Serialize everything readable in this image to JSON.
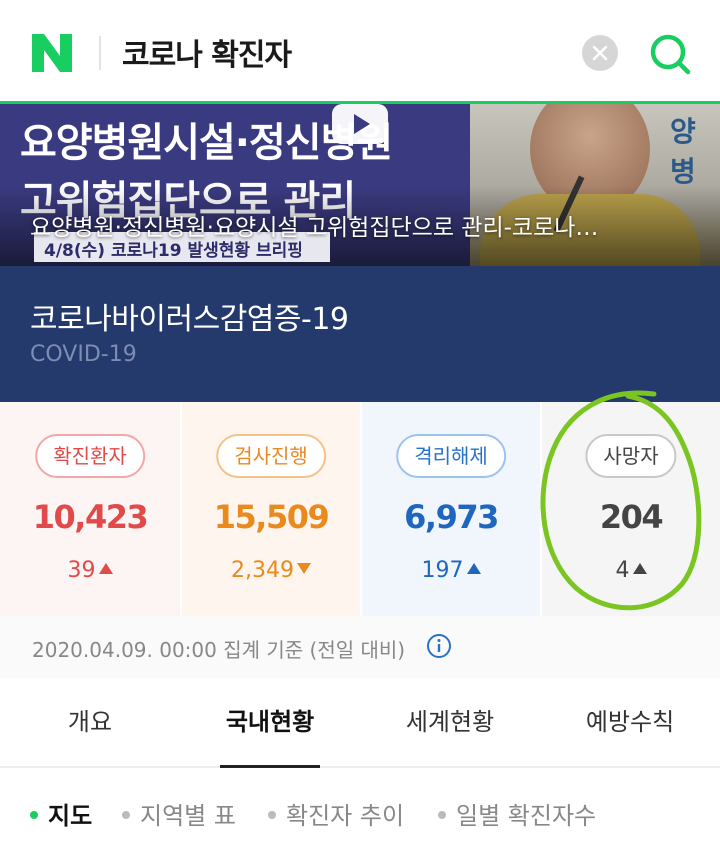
{
  "header": {
    "query": "코로나 확진자",
    "brand_color": "#19ce60"
  },
  "banner": {
    "headline_line1": "요양병원시설·정신병원",
    "headline_line2": "고위험집단으로 관리",
    "sign_text": "양병",
    "date_tag": "4/8(수) 코로나19 발생현황 브리핑",
    "caption": "요양병원·정신병원·요양시설 고위험집단으로 관리-코로나…"
  },
  "title": {
    "korean": "코로나바이러스감염증-19",
    "english": "COVID-19"
  },
  "stats": [
    {
      "label": "확진환자",
      "value": "10,423",
      "delta": "39",
      "direction": "up",
      "color": "#e04a4a"
    },
    {
      "label": "검사진행",
      "value": "15,509",
      "delta": "2,349",
      "direction": "down",
      "color": "#e98a1f"
    },
    {
      "label": "격리해제",
      "value": "6,973",
      "delta": "197",
      "direction": "up",
      "color": "#1f66bf"
    },
    {
      "label": "사망자",
      "value": "204",
      "delta": "4",
      "direction": "up",
      "color": "#444444"
    }
  ],
  "basis": {
    "text": "2020.04.09. 00:00 집계 기준 (전일 대비)"
  },
  "tabs": [
    {
      "label": "개요"
    },
    {
      "label": "국내현황",
      "active": true
    },
    {
      "label": "세계현황"
    },
    {
      "label": "예방수칙"
    }
  ],
  "subnav": [
    {
      "label": "지도",
      "active": true
    },
    {
      "label": "지역별 표"
    },
    {
      "label": "확진자 추이"
    },
    {
      "label": "일별 확진자수"
    }
  ]
}
